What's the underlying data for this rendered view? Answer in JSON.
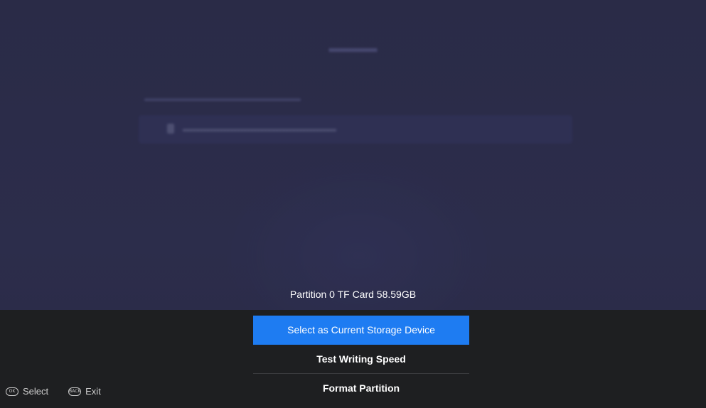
{
  "partition_title": "Partition 0  TF Card  58.59GB",
  "menu": {
    "items": [
      {
        "label": "Select as Current Storage Device",
        "selected": true
      },
      {
        "label": "Test Writing Speed",
        "selected": false
      },
      {
        "label": "Format Partition",
        "selected": false
      }
    ]
  },
  "hints": {
    "select": {
      "icon": "ok-button-icon",
      "icon_text": "OK",
      "label": "Select"
    },
    "exit": {
      "icon": "back-button-icon",
      "icon_text": "BACK",
      "label": "Exit"
    }
  },
  "colors": {
    "selected_item": "#1e7cf2",
    "panel_background": "#1e1f21",
    "overlay_background": "#2b2c49"
  }
}
